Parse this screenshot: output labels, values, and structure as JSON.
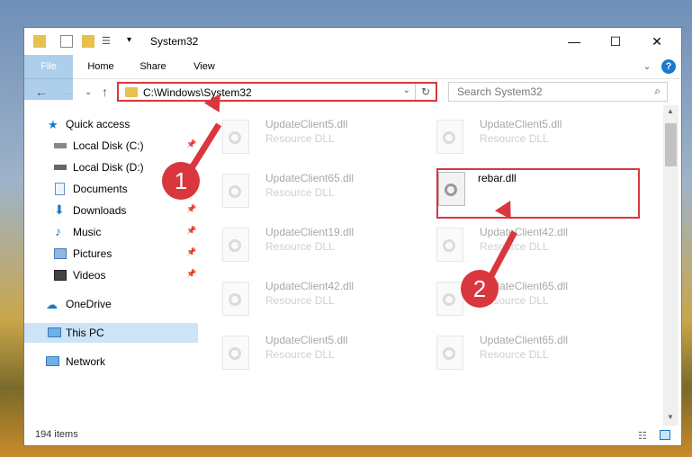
{
  "window": {
    "title": "System32",
    "controls": {
      "minimize": "—",
      "maximize": "☐",
      "close": "✕"
    }
  },
  "ribbon": {
    "tabs": [
      "File",
      "Home",
      "Share",
      "View"
    ],
    "collapse": "⌄",
    "help": "?"
  },
  "address": {
    "path": "C:\\Windows\\System32",
    "dropdown": "⌄",
    "refresh": "↻"
  },
  "search": {
    "placeholder": "Search System32",
    "icon": "⌕"
  },
  "nav": {
    "back": "←",
    "forward": "→",
    "recent": "⌄",
    "up": "↑"
  },
  "sidebar": {
    "items": [
      {
        "label": "Quick access",
        "icon": "star-icon",
        "pinned": false
      },
      {
        "label": "Local Disk (C:)",
        "icon": "drive-icon",
        "pinned": true
      },
      {
        "label": "Local Disk (D:)",
        "icon": "drive-icon",
        "pinned": true
      },
      {
        "label": "Documents",
        "icon": "documents-icon",
        "pinned": true
      },
      {
        "label": "Downloads",
        "icon": "downloads-icon",
        "pinned": true
      },
      {
        "label": "Music",
        "icon": "music-icon",
        "pinned": true
      },
      {
        "label": "Pictures",
        "icon": "pictures-icon",
        "pinned": true
      },
      {
        "label": "Videos",
        "icon": "videos-icon",
        "pinned": true
      },
      {
        "label": "OneDrive",
        "icon": "onedrive-icon",
        "pinned": false
      },
      {
        "label": "This PC",
        "icon": "computer-icon",
        "pinned": false,
        "selected": true
      },
      {
        "label": "Network",
        "icon": "network-icon",
        "pinned": false
      }
    ]
  },
  "files": [
    {
      "name": "UpdateClient5.dll",
      "type": "Resource DLL"
    },
    {
      "name": "UpdateClient5.dll",
      "type": "Resource DLL"
    },
    {
      "name": "UpdateClient65.dll",
      "type": "Resource DLL"
    },
    {
      "name": "rebar.dll",
      "type": ""
    },
    {
      "name": "UpdateClient19.dll",
      "type": "Resource DLL"
    },
    {
      "name": "UpdateClient42.dll",
      "type": "Resource DLL"
    },
    {
      "name": "UpdateClient42.dll",
      "type": "Resource DLL"
    },
    {
      "name": "UpdateClient65.dll",
      "type": "Resource DLL"
    },
    {
      "name": "UpdateClient5.dll",
      "type": "Resource DLL"
    },
    {
      "name": "UpdateClient65.dll",
      "type": "Resource DLL"
    }
  ],
  "status": {
    "count": "194 items"
  },
  "annotations": {
    "step1": "1",
    "step2": "2"
  },
  "colors": {
    "accent": "#1979ca",
    "highlight": "#d9363e",
    "selected": "#cce4f7"
  }
}
